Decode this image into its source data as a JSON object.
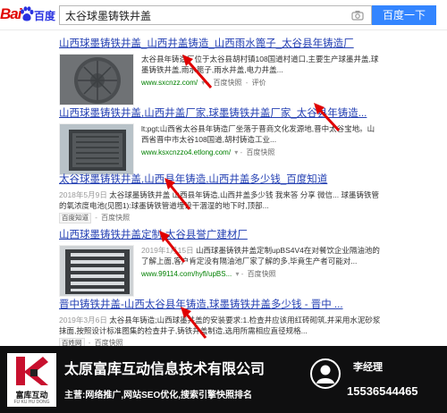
{
  "header": {
    "logo_text_1": "Bai",
    "logo_text_2": "百度",
    "search_query": "太谷球墨铸铁井盖",
    "search_button": "百度一下"
  },
  "results": [
    {
      "title": "山西球墨铸铁井盖_山西井盖铸造_山西雨水篦子_太谷县年铸造厂",
      "text": "太谷县年铸造厂位于太谷县胡村镇108国道村道口,主要生产球墨井盖,球墨铸铁井盖,雨水篦子,雨水井盖,电力井盖...",
      "url": "www.sxcnzz.com/",
      "snapshot": "百度快照",
      "rating": "评价"
    },
    {
      "title": "山西球墨铸铁井盖,山西井盖厂家,球墨铸铁井盖厂家_太谷县年铸造...",
      "text": "lt;pgt;山西省太谷县年铸造厂坐落于晋商文化发源地,晋中太谷宝地。山西省晋中市太谷108国道,胡村铸造工业...",
      "url": "www.ksxcnzzo4.etlong.com/",
      "snapshot": "百度快照"
    },
    {
      "title": "太谷球墨铸铁井盖,山西县年铸造,山西井盖多少钱_百度知道",
      "date": "2018年5月9日",
      "text": "太谷球墨铸铁井盖 山西县年铸造,山西井盖多少钱 我来答 分享 微信... 球墨铸铁管的氧浓度电池(见图1):球墨铸铁管道埋设干涸湿的地下时,顶部...",
      "badge": "百度知道",
      "snapshot": "百度快照"
    },
    {
      "title": "山西球墨铸铁井盖定制-太谷县誉广建材厂",
      "date": "2019年1月15日",
      "text": "山西球墨铸铁井盖定制upBS4V4在对餐饮企业隔油池的了解上面,客户肯定没有隔油池厂家了解的多,毕竟生产者可能对...",
      "url": "www.99114.com/hyfl/upBS...",
      "snapshot": "百度快照"
    },
    {
      "title": "晋中铸铁井盖-山西太谷县年铸造,球墨铸铁井盖多少钱 - 晋中 ...",
      "date": "2019年3月6日",
      "text": "太谷县年铸造;山西球墨井盖的安装要求:1.检查井应该用红砖砌筑,并采用水泥砂浆抹面,按照设计标准图集的检查井子,铸铁井盖制造,选用所需相应直径规格...",
      "badge": "百姓网",
      "snapshot": "百度快照"
    }
  ],
  "footer": {
    "logo_name": "富库互动",
    "logo_sub": "FU KU HU DONG",
    "company": "太原富库互动信息技术有限公司",
    "main_business": "主营:网络推广,网站SEO优化,搜索引擎快照排名",
    "contact_name": "李经理",
    "phone": "15536544465"
  },
  "colors": {
    "link": "#2440b3",
    "highlight": "#c00000",
    "url_green": "#008000",
    "button": "#3385ff",
    "footer_bg": "#0f0f10"
  }
}
